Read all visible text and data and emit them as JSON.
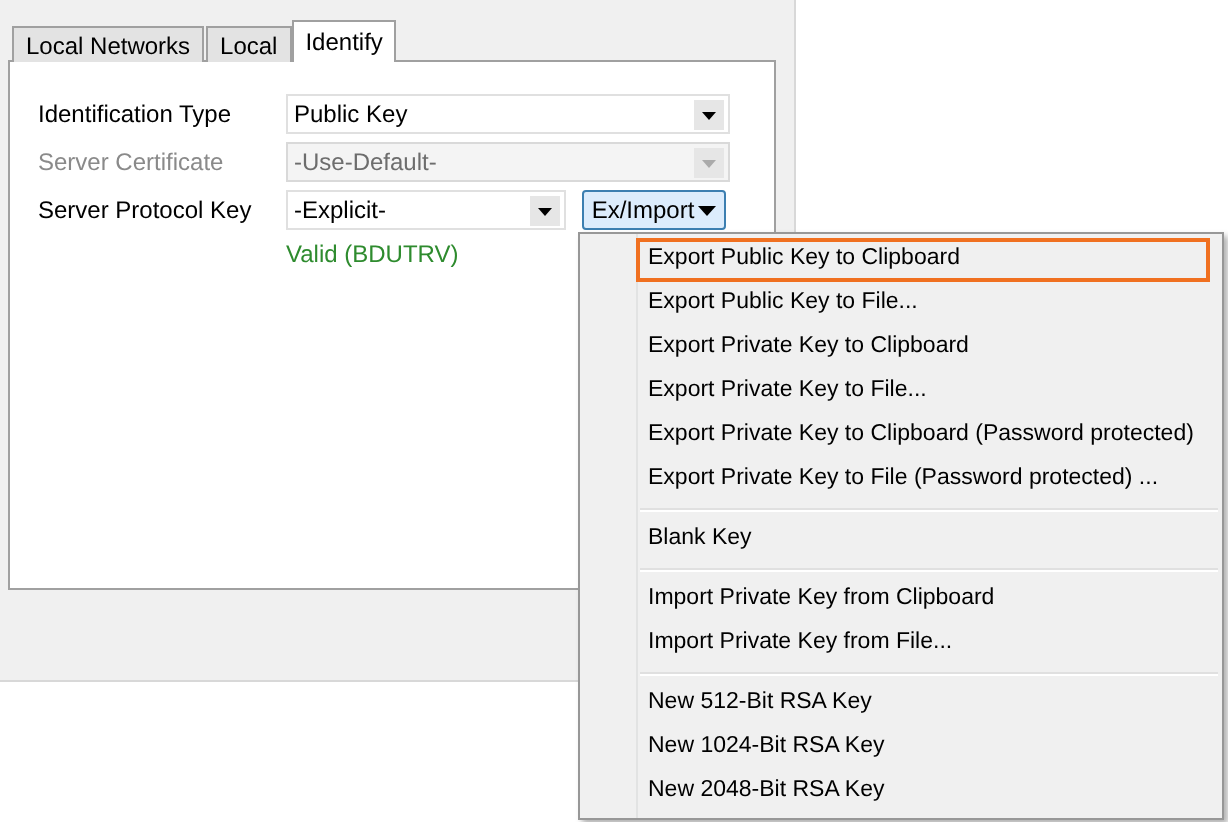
{
  "tabs": [
    {
      "label": "Local Networks",
      "selected": false
    },
    {
      "label": "Local",
      "selected": false
    },
    {
      "label": "Identify",
      "selected": true
    }
  ],
  "form": {
    "rows": [
      {
        "label": "Identification Type",
        "value": "Public Key",
        "disabled": false,
        "kind": "wide"
      },
      {
        "label": "Server Certificate",
        "value": "-Use-Default-",
        "disabled": true,
        "kind": "wide"
      },
      {
        "label": "Server Protocol Key",
        "value": "-Explicit-",
        "disabled": false,
        "kind": "narrow",
        "button": "Ex/Import"
      }
    ],
    "status": "Valid (BDUTRV)"
  },
  "menu": {
    "items": [
      {
        "kind": "item",
        "label": "Export Public Key to Clipboard",
        "selected": true
      },
      {
        "kind": "item",
        "label": "Export Public Key to File...",
        "selected": false
      },
      {
        "kind": "item",
        "label": "Export Private Key to Clipboard",
        "selected": false
      },
      {
        "kind": "item",
        "label": "Export Private Key to File...",
        "selected": false
      },
      {
        "kind": "item",
        "label": "Export Private Key to Clipboard (Password protected)",
        "selected": false
      },
      {
        "kind": "item",
        "label": "Export Private Key to File (Password protected) ...",
        "selected": false
      },
      {
        "kind": "separator"
      },
      {
        "kind": "item",
        "label": "Blank Key",
        "selected": false
      },
      {
        "kind": "separator"
      },
      {
        "kind": "item",
        "label": "Import Private Key from Clipboard",
        "selected": false
      },
      {
        "kind": "item",
        "label": "Import Private Key from File...",
        "selected": false
      },
      {
        "kind": "separator"
      },
      {
        "kind": "item",
        "label": "New 512-Bit RSA Key",
        "selected": false
      },
      {
        "kind": "item",
        "label": "New 1024-Bit RSA Key",
        "selected": false
      },
      {
        "kind": "item",
        "label": "New 2048-Bit RSA Key",
        "selected": false
      }
    ]
  }
}
